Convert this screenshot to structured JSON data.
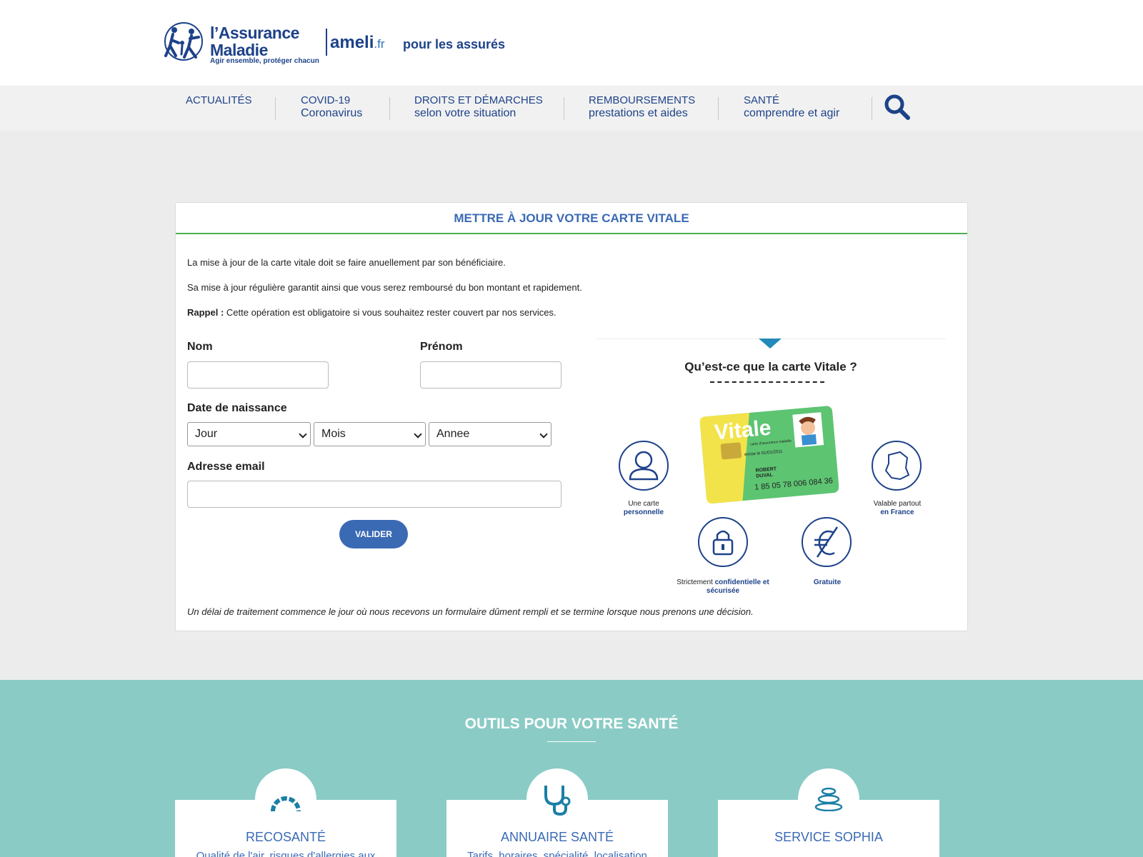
{
  "header": {
    "logo_line1": "l’Assurance",
    "logo_line2": "Maladie",
    "logo_tagline": "Agir ensemble, protéger chacun",
    "site_name": "ameli",
    "site_tld": ".fr",
    "audience": "pour les assurés"
  },
  "nav": [
    {
      "line1": "Actualités",
      "line2": ""
    },
    {
      "line1": "COVID-19",
      "line2": "Coronavirus"
    },
    {
      "line1": "Droits et démarches",
      "line2": "selon votre situation"
    },
    {
      "line1": "Remboursements",
      "line2": "prestations et aides"
    },
    {
      "line1": "Santé",
      "line2": "comprendre et agir"
    }
  ],
  "card": {
    "title": "Mettre à jour votre carte vitale",
    "para1": "La mise à jour de la carte vitale doit se faire anuellement par son bénéficiaire.",
    "para2": "Sa mise à jour régulière garantit ainsi que vous serez remboursé du bon montant et rapidement.",
    "rappel_label": "Rappel :",
    "rappel_text": " Cette opération est obligatoire si vous souhaitez rester couvert par nos services.",
    "form": {
      "nom_label": "Nom",
      "prenom_label": "Prénom",
      "dob_label": "Date de naissance",
      "day_selected": "Jour",
      "month_selected": "Mois",
      "year_selected": "Annee",
      "email_label": "Adresse email",
      "submit_label": "VALIDER"
    },
    "note": "Un délai de traitement commence le jour où nous recevons un formulaire dûment rempli et se termine lorsque nous prenons une décision.",
    "info": {
      "title": "Qu’est-ce que la carte Vitale ?",
      "card_brand": "Vitale",
      "card_sub": "carte d'assurance maladie",
      "card_issued": "émise le 01/01/2011",
      "card_holder": "ROBERT DUVAL",
      "card_number": "1 85 05 78 006 084 36",
      "features": [
        {
          "icon": "person-icon",
          "text": "Une carte",
          "bold": "personnelle"
        },
        {
          "icon": "france-map-icon",
          "text": "Valable partout",
          "bold": "en France"
        },
        {
          "icon": "lock-icon",
          "text": "Strictement",
          "bold": "confidentielle et sécurisée"
        },
        {
          "icon": "euro-crossed-icon",
          "text": "",
          "bold": "Gratuite"
        }
      ]
    }
  },
  "tools": {
    "title": "Outils pour votre santé",
    "items": [
      {
        "name": "Recosanté",
        "desc": "Qualité de l'air, risques d'allergies aux",
        "icon": "gauge-icon"
      },
      {
        "name": "Annuaire santé",
        "desc": "Tarifs, horaires, spécialité, localisation",
        "icon": "stethoscope-icon"
      },
      {
        "name": "Service sophia",
        "desc": "",
        "icon": "stones-icon"
      }
    ]
  },
  "colors": {
    "brand_blue": "#1d4289",
    "accent_blue": "#3a6ab4",
    "green_rule": "#4caf50",
    "teal_section": "#8acbc5"
  }
}
